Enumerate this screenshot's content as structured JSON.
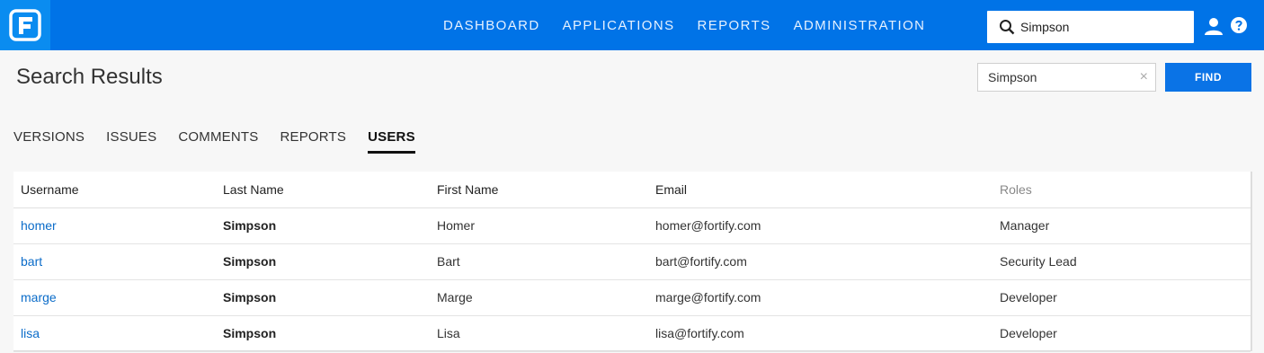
{
  "nav": {
    "items": [
      "DASHBOARD",
      "APPLICATIONS",
      "REPORTS",
      "ADMINISTRATION"
    ],
    "search_value": "Simpson"
  },
  "page": {
    "title": "Search Results",
    "find_value": "Simpson",
    "find_label": "FIND",
    "clear_glyph": "×"
  },
  "tabs": [
    {
      "label": "VERSIONS",
      "active": false
    },
    {
      "label": "ISSUES",
      "active": false
    },
    {
      "label": "COMMENTS",
      "active": false
    },
    {
      "label": "REPORTS",
      "active": false
    },
    {
      "label": "USERS",
      "active": true
    }
  ],
  "table": {
    "headers": [
      "Username",
      "Last Name",
      "First Name",
      "Email",
      "Roles"
    ],
    "rows": [
      {
        "username": "homer",
        "last": "Simpson",
        "first": "Homer",
        "email": "homer@fortify.com",
        "role": "Manager"
      },
      {
        "username": "bart",
        "last": "Simpson",
        "first": "Bart",
        "email": "bart@fortify.com",
        "role": "Security Lead"
      },
      {
        "username": "marge",
        "last": "Simpson",
        "first": "Marge",
        "email": "marge@fortify.com",
        "role": "Developer"
      },
      {
        "username": "lisa",
        "last": "Simpson",
        "first": "Lisa",
        "email": "lisa@fortify.com",
        "role": "Developer"
      }
    ]
  },
  "icons": {
    "logo": "fortify-logo-icon",
    "search": "search-icon",
    "user": "user-icon",
    "help": "help-icon"
  },
  "colors": {
    "topbar": "#0073e7",
    "accent": "#0a73e6",
    "link": "#0b6cc9"
  }
}
